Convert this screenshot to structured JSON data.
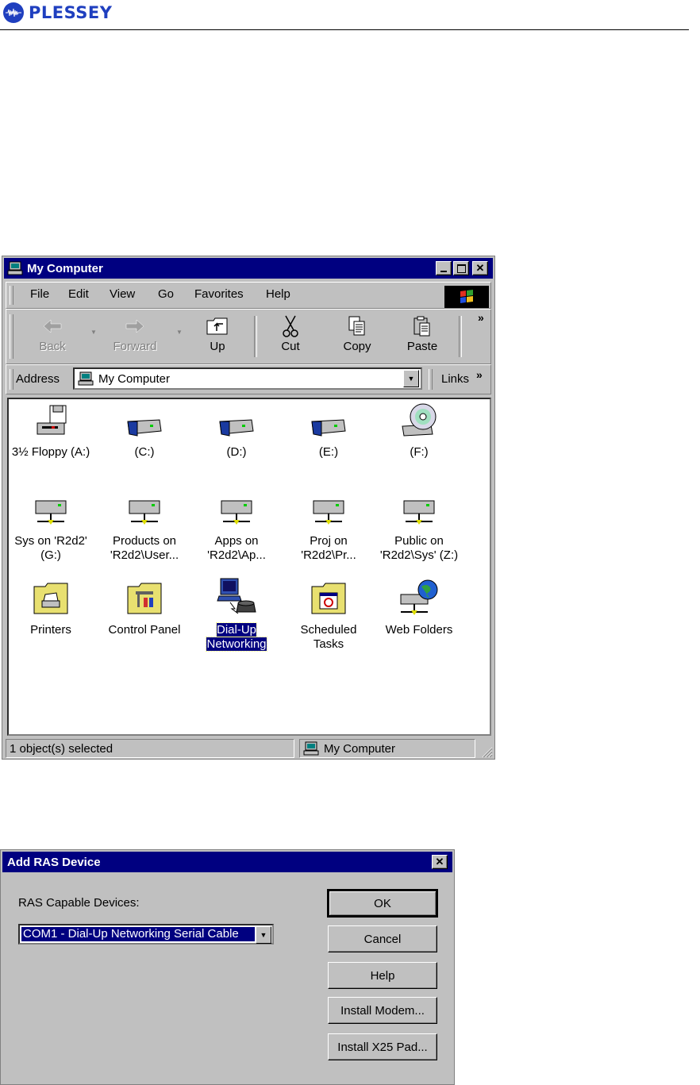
{
  "header": {
    "brand": "PLESSEY",
    "brand_color": "#1f3fbf"
  },
  "explorer": {
    "title": "My Computer",
    "menu": [
      {
        "label": "File"
      },
      {
        "label": "Edit"
      },
      {
        "label": "View"
      },
      {
        "label": "Go"
      },
      {
        "label": "Favorites"
      },
      {
        "label": "Help"
      }
    ],
    "toolbar": {
      "back": "Back",
      "forward": "Forward",
      "up": "Up",
      "cut": "Cut",
      "copy": "Copy",
      "paste": "Paste",
      "more": "»"
    },
    "address": {
      "label": "Address",
      "value": "My Computer",
      "links": "Links",
      "more": "»"
    },
    "items": [
      {
        "label": "3½ Floppy (A:)",
        "icon": "floppy-drive-icon"
      },
      {
        "label": "(C:)",
        "icon": "hard-drive-icon"
      },
      {
        "label": "(D:)",
        "icon": "hard-drive-icon"
      },
      {
        "label": "(E:)",
        "icon": "hard-drive-icon"
      },
      {
        "label": "(F:)",
        "icon": "cd-drive-icon"
      },
      {
        "label1": "Sys on 'R2d2'",
        "label2": "(G:)",
        "icon": "network-drive-icon"
      },
      {
        "label1": "Products on",
        "label2": "'R2d2\\User...",
        "icon": "network-drive-icon"
      },
      {
        "label1": "Apps on",
        "label2": "'R2d2\\Ap...",
        "icon": "network-drive-icon"
      },
      {
        "label1": "Proj on",
        "label2": "'R2d2\\Pr...",
        "icon": "network-drive-icon"
      },
      {
        "label1": "Public on",
        "label2": "'R2d2\\Sys' (Z:)",
        "icon": "network-drive-icon"
      },
      {
        "label": "Printers",
        "icon": "printers-folder-icon"
      },
      {
        "label": "Control Panel",
        "icon": "control-panel-icon"
      },
      {
        "label1": "Dial-Up",
        "label2": "Networking",
        "icon": "dial-up-networking-icon",
        "selected": true
      },
      {
        "label1": "Scheduled",
        "label2": "Tasks",
        "icon": "scheduled-tasks-icon"
      },
      {
        "label": "Web Folders",
        "icon": "web-folders-icon"
      }
    ],
    "status": {
      "left": "1 object(s) selected",
      "right": "My Computer"
    }
  },
  "dialog": {
    "title": "Add RAS Device",
    "devices_label": "RAS Capable Devices:",
    "selected_device": "COM1 - Dial-Up Networking Serial Cable",
    "buttons": {
      "ok": "OK",
      "cancel": "Cancel",
      "help": "Help",
      "install_modem": "Install Modem...",
      "install_x25": "Install X25 Pad..."
    }
  },
  "colors": {
    "titlebar": "#000080",
    "face": "#c0c0c0",
    "selection": "#000080"
  }
}
